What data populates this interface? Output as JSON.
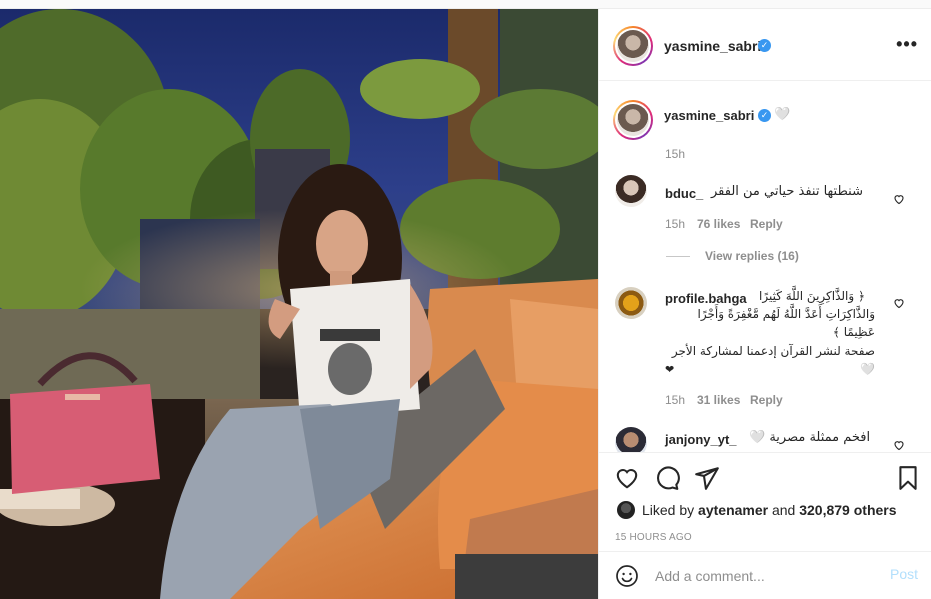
{
  "post": {
    "author": {
      "username": "yasmine_sabri",
      "verified": true
    },
    "caption": {
      "username": "yasmine_sabri",
      "emoji": "🤍",
      "time": "15h"
    },
    "comments": [
      {
        "username": "bduc_",
        "text": "شنطتها تنفذ حياتي من الفقر",
        "time": "15h",
        "likes": "76 likes",
        "reply": "Reply",
        "view_replies": "View replies (16)"
      },
      {
        "username": "profile.bahga",
        "text_line1": "﴿ وَالذَّاكِرِينَ اللَّهَ كَثِيرًا",
        "text_line2": "وَالذَّاكِرَاتِ أَعَدَّ اللَّهُ لَهُم مَّغْفِرَةً وَأَجْرًا عَظِيمًا ﴾",
        "text_line3": "صفحة لنشر القرآن إدعمنا لمشاركة الأجر 🤍",
        "text_line4": "❤",
        "time": "15h",
        "likes": "31 likes",
        "reply": "Reply"
      },
      {
        "username": "janjony_yt_",
        "text": "افخم ممثلة مصرية 🤍"
      }
    ],
    "likes": {
      "prefix": "Liked by",
      "liker": "aytenamer",
      "middle": "and",
      "others": "320,879 others"
    },
    "time_ago": "15 HOURS AGO",
    "add_comment": {
      "placeholder": "Add a comment...",
      "post_label": "Post"
    },
    "icons": {
      "more": "more-options-icon",
      "verified": "verified-badge-icon",
      "like": "heart-icon",
      "comment": "comment-icon",
      "share": "share-icon",
      "save": "bookmark-icon",
      "emoji": "emoji-icon"
    },
    "colors": {
      "verified": "#3897f0",
      "post_disabled": "#b2dffc",
      "muted": "#8e8e8e",
      "text": "#262626"
    }
  }
}
